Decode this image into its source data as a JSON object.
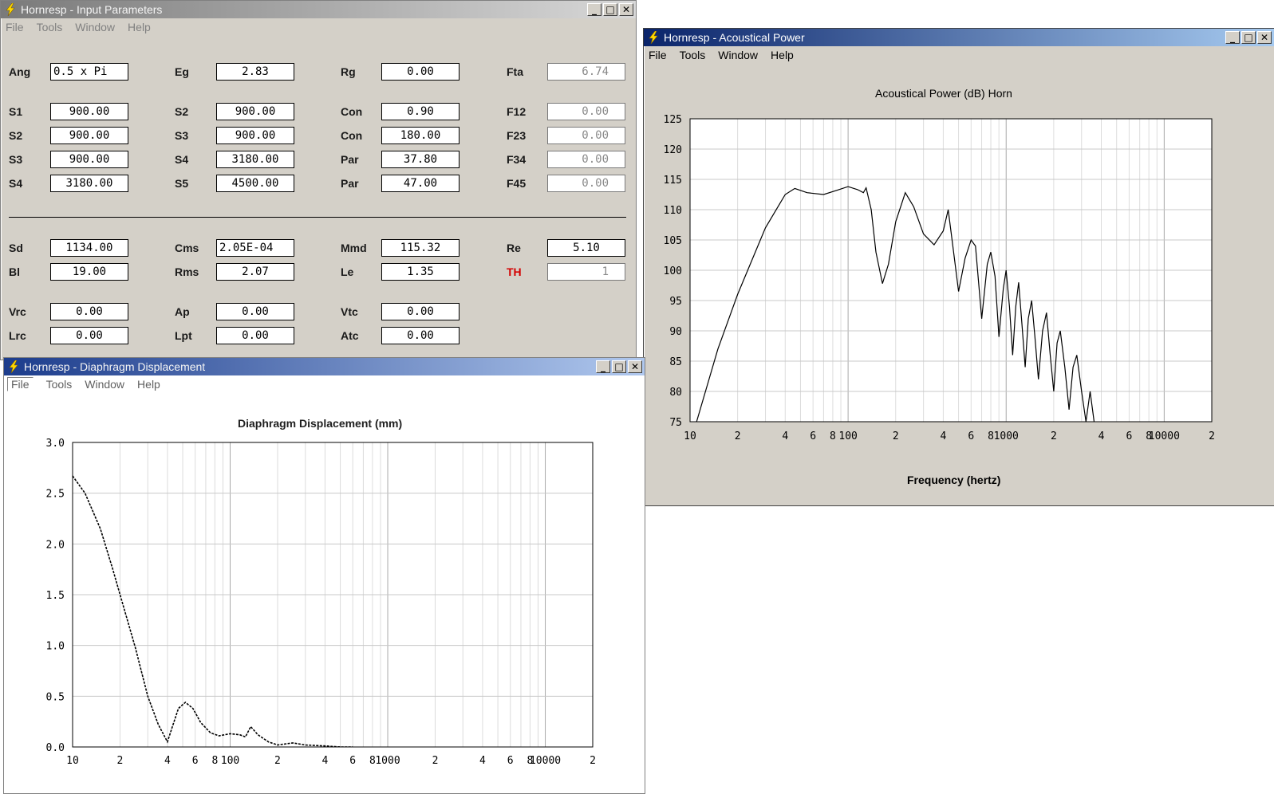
{
  "input_window": {
    "title": "Hornresp - Input Parameters",
    "menu": [
      "File",
      "Tools",
      "Window",
      "Help"
    ],
    "buttons": {
      "minimize": "_",
      "maximize": "□",
      "close": "✕"
    },
    "rows_top": [
      [
        {
          "label": "Ang",
          "value": "0.5 x Pi"
        },
        {
          "label": "Eg",
          "value": "2.83"
        },
        {
          "label": "Rg",
          "value": "0.00"
        },
        {
          "label": "Fta",
          "value": "6.74"
        }
      ],
      [
        {
          "label": "S1",
          "value": "900.00"
        },
        {
          "label": "S2",
          "value": "900.00"
        },
        {
          "label": "Con",
          "value": "0.90"
        },
        {
          "label": "F12",
          "value": "0.00"
        }
      ],
      [
        {
          "label": "S2",
          "value": "900.00"
        },
        {
          "label": "S3",
          "value": "900.00"
        },
        {
          "label": "Con",
          "value": "180.00"
        },
        {
          "label": "F23",
          "value": "0.00"
        }
      ],
      [
        {
          "label": "S3",
          "value": "900.00"
        },
        {
          "label": "S4",
          "value": "3180.00"
        },
        {
          "label": "Par",
          "value": "37.80"
        },
        {
          "label": "F34",
          "value": "0.00"
        }
      ],
      [
        {
          "label": "S4",
          "value": "3180.00"
        },
        {
          "label": "S5",
          "value": "4500.00"
        },
        {
          "label": "Par",
          "value": "47.00"
        },
        {
          "label": "F45",
          "value": "0.00"
        }
      ]
    ],
    "rows_mid": [
      [
        {
          "label": "Sd",
          "value": "1134.00"
        },
        {
          "label": "Cms",
          "value": "2.05E-04"
        },
        {
          "label": "Mmd",
          "value": "115.32"
        },
        {
          "label": "Re",
          "value": "5.10"
        }
      ],
      [
        {
          "label": "Bl",
          "value": "19.00"
        },
        {
          "label": "Rms",
          "value": "2.07"
        },
        {
          "label": "Le",
          "value": "1.35"
        },
        {
          "label": "TH",
          "value": "1"
        }
      ]
    ],
    "rows_bot": [
      [
        {
          "label": "Vrc",
          "value": "0.00"
        },
        {
          "label": "Ap",
          "value": "0.00"
        },
        {
          "label": "Vtc",
          "value": "0.00"
        }
      ],
      [
        {
          "label": "Lrc",
          "value": "0.00"
        },
        {
          "label": "Lpt",
          "value": "0.00"
        },
        {
          "label": "Atc",
          "value": "0.00"
        }
      ]
    ],
    "th_color": "#d40000"
  },
  "power_window": {
    "title": "Hornresp - Acoustical Power",
    "menu": [
      "File",
      "Tools",
      "Window",
      "Help"
    ],
    "buttons": {
      "minimize": "_",
      "maximize": "□",
      "close": "✕"
    },
    "chart_title": "Acoustical Power (dB)   Horn",
    "x_title": "Frequency (hertz)"
  },
  "disp_window": {
    "title": "Hornresp - Diaphragm Displacement",
    "menu": [
      "File",
      "Tools",
      "Window",
      "Help"
    ],
    "buttons": {
      "minimize": "_",
      "maximize": "□",
      "close": "✕"
    },
    "chart_title": "Diaphragm Displacement (mm)"
  },
  "chart_data": [
    {
      "type": "line",
      "title": "Acoustical Power (dB)   Horn",
      "xlabel": "Frequency (hertz)",
      "ylabel": "",
      "x_scale": "log",
      "xlim": [
        10,
        20000
      ],
      "ylim": [
        75,
        125
      ],
      "yticks": [
        "125",
        "120",
        "115",
        "110",
        "105",
        "100",
        "95",
        "90",
        "85",
        "80",
        "75"
      ],
      "xticks": [
        "10",
        "2",
        "4",
        "6",
        "8",
        "100",
        "2",
        "4",
        "6",
        "8",
        "1000",
        "2",
        "4",
        "6",
        "8",
        "10000",
        "2"
      ],
      "grid": true,
      "series": [
        {
          "x": [
            11,
            15,
            20,
            30,
            40,
            46,
            55,
            70,
            85,
            100,
            115,
            125,
            130,
            140,
            150,
            165,
            180,
            200,
            230,
            260,
            300,
            350,
            400,
            430,
            460,
            500,
            550,
            600,
            640,
            700,
            760,
            800,
            850,
            900,
            960,
            1000,
            1050,
            1100,
            1150,
            1200,
            1260,
            1320,
            1380,
            1450,
            1520,
            1600,
            1700,
            1800,
            1900,
            2000,
            2100,
            2200,
            2350,
            2500,
            2650,
            2800,
            3000,
            3200,
            3400,
            3600
          ],
          "y": [
            75,
            87,
            96,
            107,
            112.5,
            113.5,
            112.8,
            112.5,
            113.2,
            113.8,
            113.3,
            112.8,
            113.6,
            110,
            103,
            97.8,
            101,
            108,
            112.8,
            110.5,
            106,
            104.2,
            106.5,
            110,
            104,
            96.5,
            102,
            105,
            104,
            92,
            101,
            103,
            99,
            89,
            97,
            100,
            94,
            86,
            94,
            98,
            91,
            84,
            92,
            95,
            89,
            82,
            90,
            93,
            86,
            80,
            88,
            90,
            84,
            77,
            84,
            86,
            80,
            75,
            80,
            75
          ]
        }
      ]
    },
    {
      "type": "line",
      "title": "Diaphragm Displacement (mm)",
      "xlabel": "",
      "ylabel": "",
      "x_scale": "log",
      "xlim": [
        10,
        20000
      ],
      "ylim": [
        0,
        3
      ],
      "yticks": [
        "3.0",
        "2.5",
        "2.0",
        "1.5",
        "1.0",
        "0.5",
        "0.0"
      ],
      "xticks": [
        "10",
        "2",
        "4",
        "6",
        "8",
        "100",
        "2",
        "4",
        "6",
        "8",
        "1000",
        "2",
        "4",
        "6",
        "8",
        "10000",
        "2"
      ],
      "grid": true,
      "series": [
        {
          "x": [
            10,
            12,
            15,
            18,
            20,
            25,
            30,
            35,
            40,
            43,
            47,
            52,
            58,
            65,
            75,
            85,
            100,
            115,
            125,
            135,
            150,
            175,
            200,
            250,
            300,
            400,
            500,
            600
          ],
          "y": [
            2.67,
            2.5,
            2.15,
            1.75,
            1.5,
            0.98,
            0.5,
            0.22,
            0.05,
            0.2,
            0.38,
            0.44,
            0.38,
            0.24,
            0.14,
            0.11,
            0.13,
            0.12,
            0.1,
            0.2,
            0.12,
            0.05,
            0.02,
            0.04,
            0.02,
            0.01,
            0.0,
            0.0
          ]
        }
      ]
    }
  ]
}
